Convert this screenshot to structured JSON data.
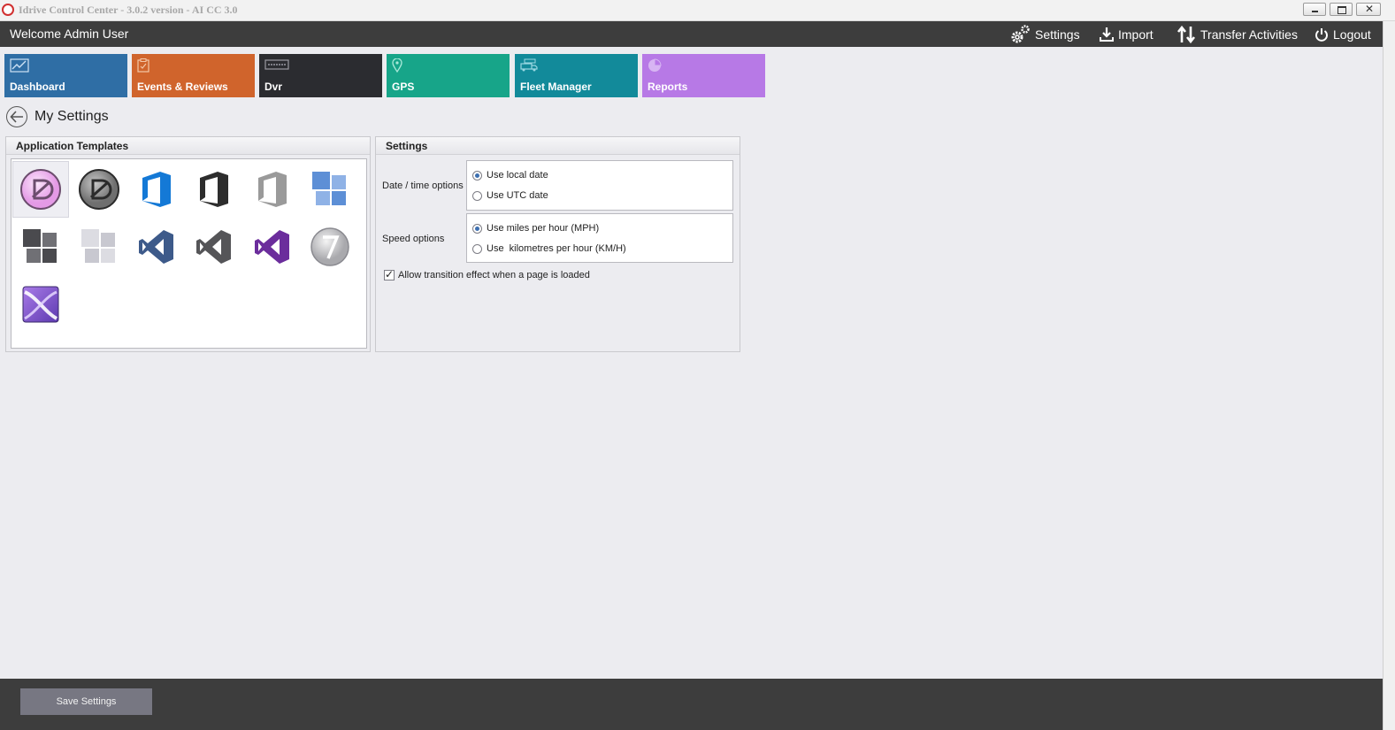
{
  "window": {
    "title": "Idrive Control Center - 3.0.2 version - AI CC 3.0"
  },
  "header": {
    "welcome": "Welcome Admin User",
    "settings_label": "Settings",
    "import_label": "Import",
    "transfer_label": "Transfer Activities",
    "logout_label": "Logout"
  },
  "tiles": {
    "dashboard": "Dashboard",
    "events": "Events & Reviews",
    "dvr": "Dvr",
    "gps": "GPS",
    "fleet": "Fleet Manager",
    "reports": "Reports"
  },
  "page": {
    "title": "My Settings"
  },
  "templates_panel": {
    "title": "Application Templates",
    "selected": "template-1"
  },
  "settings_panel": {
    "title": "Settings",
    "date_time_label": "Date / time options",
    "date_options": [
      "Use local date",
      "Use UTC date"
    ],
    "date_selected": "Use local date",
    "speed_label": "Speed options",
    "speed_options": [
      "Use miles per hour (MPH)",
      "Use  kilometres per hour (KM/H)"
    ],
    "speed_selected": "Use miles per hour (MPH)",
    "transition_label": "Allow transition effect when a page is loaded",
    "transition_checked": true
  },
  "footer": {
    "save_label": "Save Settings"
  },
  "colors": {
    "header_bg": "#3d3d3d",
    "dashboard": "#2f6ea5",
    "events": "#d0642c",
    "dvr": "#2b2c30",
    "gps": "#17a589",
    "fleet": "#128a9a",
    "reports": "#b779e6"
  }
}
